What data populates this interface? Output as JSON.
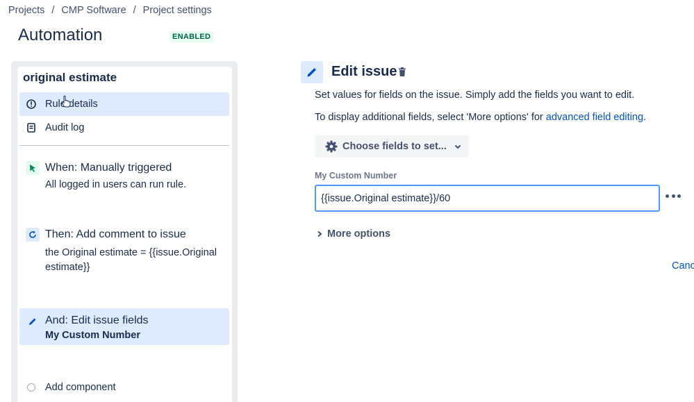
{
  "breadcrumb": {
    "items": [
      "Projects",
      "CMP Software",
      "Project settings"
    ],
    "separator": "/"
  },
  "page": {
    "title": "Automation",
    "status": "ENABLED"
  },
  "sidebar": {
    "rule_name": "original estimate",
    "nav": [
      {
        "label": "Rule details",
        "icon": "info-icon",
        "active": true
      },
      {
        "label": "Audit log",
        "icon": "audit-log-icon",
        "active": false
      }
    ],
    "components": [
      {
        "title": "When: Manually triggered",
        "subtitle": "All logged in users can run rule.",
        "icon": "cursor-click-icon"
      },
      {
        "title": "Then: Add comment to issue",
        "subtitle": "the Original estimate = {{issue.Original estimate}}",
        "icon": "refresh-icon"
      },
      {
        "title": "And: Edit issue fields",
        "subtitle": "My Custom Number",
        "icon": "pencil-icon",
        "active": true
      }
    ],
    "add_component": "Add component"
  },
  "editor": {
    "title": "Edit issue",
    "description": "Set values for fields on the issue. Simply add the fields you want to edit.",
    "more_prefix": "To display additional fields, select 'More options' for ",
    "more_link": "advanced field editing",
    "more_suffix": ".",
    "choose_button": "Choose fields to set...",
    "field": {
      "label": "My Custom Number",
      "value": "{{issue.Original estimate}}/60"
    },
    "more_options": "More options",
    "cancel": "Cancel"
  },
  "colors": {
    "accent": "#0052cc",
    "active_bg": "#deebff",
    "status_green": "#006644",
    "trigger_green": "#00875a",
    "focus_border": "#4c9aff"
  }
}
